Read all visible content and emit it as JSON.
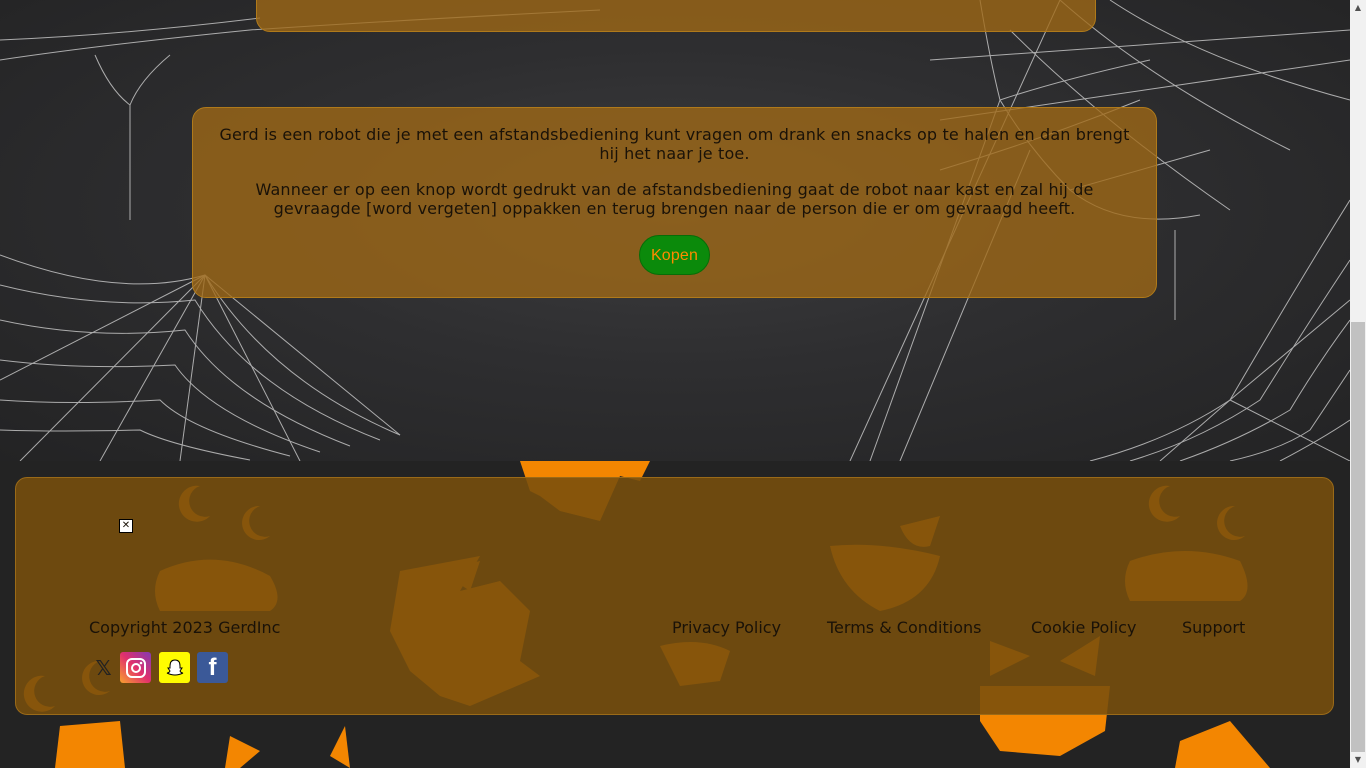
{
  "product": {
    "description_1": "Gerd is een robot die je met een afstandsbediening kunt vragen om drank en snacks op te halen en dan brengt hij het naar je toe.",
    "description_2": "Wanneer er op een knop wordt gedrukt van de afstandsbediening gaat de robot naar kast en zal hij de gevraagde [word vergeten] oppakken en terug brengen naar de person die er om gevraagd heeft.",
    "buy_label": "Kopen"
  },
  "footer": {
    "copyright": "Copyright 2023 GerdInc",
    "links": {
      "privacy": "Privacy Policy",
      "terms": "Terms & Conditions",
      "cookie": "Cookie Policy",
      "support": "Support"
    },
    "social": {
      "x": "x-icon",
      "instagram": "instagram-icon",
      "snapchat": "snapchat-icon",
      "facebook": "facebook-icon"
    },
    "broken_image_icon": "broken-image-icon"
  },
  "colors": {
    "card_bg": "#a0691699",
    "buy_button": "#0b8a0b",
    "buy_text": "#ff8a00",
    "pumpkin": "#ff8c00"
  }
}
